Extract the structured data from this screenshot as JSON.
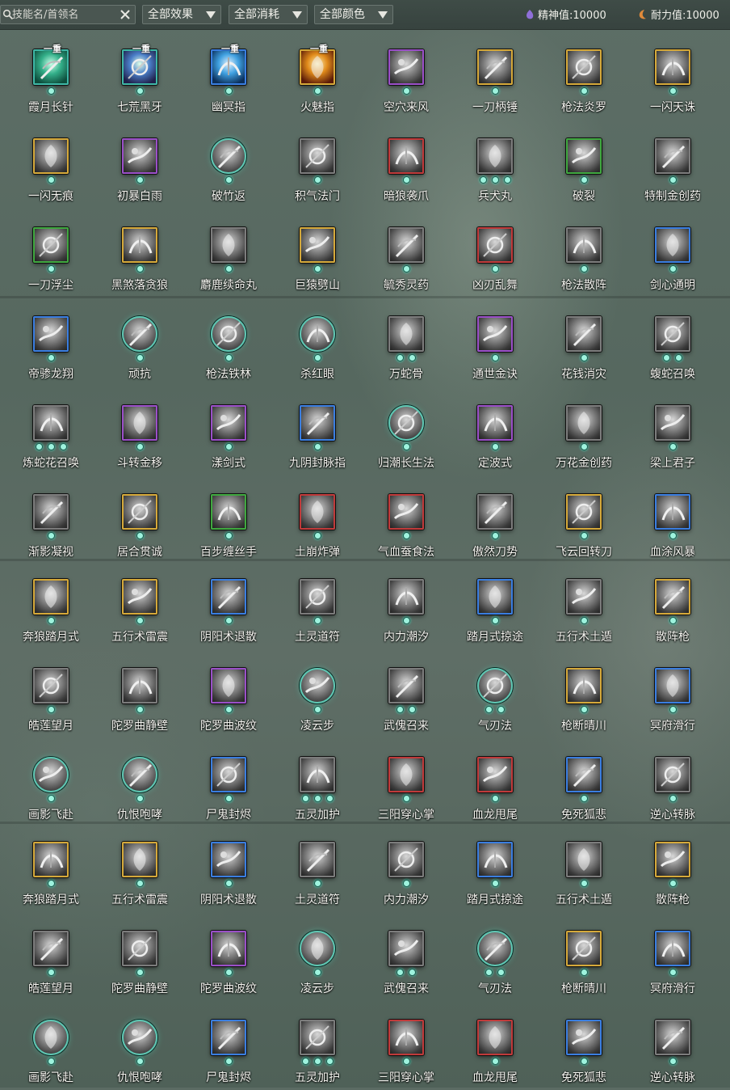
{
  "toolbar": {
    "search_placeholder": "技能名/首领名",
    "filter_effect": "全部效果",
    "filter_cost": "全部消耗",
    "filter_color": "全部颜色"
  },
  "stats": {
    "spirit_label": "精神值:",
    "spirit_value": "10000",
    "endurance_label": "耐力值:",
    "endurance_value": "10000"
  },
  "skills": [
    {
      "name": "霞月长针",
      "badge": "一重",
      "frame": "teal",
      "tint": "teal",
      "dots": 1
    },
    {
      "name": "七荒黑牙",
      "badge": "一重",
      "frame": "teal",
      "tint": "violet",
      "dots": 1
    },
    {
      "name": "幽冥指",
      "badge": "一重",
      "frame": "blue",
      "tint": "blue",
      "dots": 1
    },
    {
      "name": "火魅指",
      "badge": "一重",
      "frame": "gold",
      "tint": "fire",
      "dots": 1
    },
    {
      "name": "空穴来风",
      "frame": "purple",
      "dots": 1
    },
    {
      "name": "一刀柄锤",
      "frame": "gold",
      "dots": 1
    },
    {
      "name": "枪法炎罗",
      "frame": "gold",
      "dots": 1
    },
    {
      "name": "一闪天诛",
      "frame": "gold",
      "dots": 1
    },
    {
      "name": "一闪无痕",
      "frame": "gold",
      "dots": 1
    },
    {
      "name": "初暴白雨",
      "frame": "purple",
      "dots": 1
    },
    {
      "name": "破竹返",
      "frame": "circle",
      "dots": 1
    },
    {
      "name": "积气法门",
      "frame": "gray",
      "dots": 1
    },
    {
      "name": "暗狼袭爪",
      "frame": "red",
      "dots": 1
    },
    {
      "name": "兵犬丸",
      "frame": "gray",
      "dots": 3
    },
    {
      "name": "破裂",
      "frame": "green",
      "dots": 1
    },
    {
      "name": "特制金创药",
      "frame": "gray",
      "dots": 1
    },
    {
      "name": "一刀浮尘",
      "frame": "green",
      "dots": 1
    },
    {
      "name": "黑煞落贪狼",
      "frame": "gold",
      "dots": 1
    },
    {
      "name": "麝鹿续命丸",
      "frame": "gray",
      "dots": 1
    },
    {
      "name": "巨猿劈山",
      "frame": "gold",
      "dots": 1
    },
    {
      "name": "毓秀灵药",
      "frame": "gray",
      "dots": 1
    },
    {
      "name": "凶刃乱舞",
      "frame": "red",
      "dots": 1
    },
    {
      "name": "枪法散阵",
      "frame": "gray",
      "dots": 1
    },
    {
      "name": "剑心通明",
      "frame": "blue",
      "dots": 1
    },
    {
      "name": "帝骖龙翔",
      "frame": "blue",
      "dots": 1
    },
    {
      "name": "顽抗",
      "frame": "circle",
      "dots": 1
    },
    {
      "name": "枪法铁林",
      "frame": "circle",
      "dots": 1
    },
    {
      "name": "杀红眼",
      "frame": "circle",
      "dots": 1
    },
    {
      "name": "万蛇骨",
      "frame": "gray",
      "dots": 2
    },
    {
      "name": "通世金诀",
      "frame": "purple",
      "dots": 1
    },
    {
      "name": "花钱消灾",
      "frame": "gray",
      "dots": 1
    },
    {
      "name": "蝮蛇召唤",
      "frame": "gray",
      "dots": 2
    },
    {
      "name": "炼蛇花召唤",
      "frame": "gray",
      "dots": 3
    },
    {
      "name": "斗转金移",
      "frame": "purple",
      "dots": 1
    },
    {
      "name": "漾剑式",
      "frame": "purple",
      "dots": 1
    },
    {
      "name": "九阴封脉指",
      "frame": "blue",
      "dots": 1
    },
    {
      "name": "归潮长生法",
      "frame": "circle",
      "dots": 1
    },
    {
      "name": "定波式",
      "frame": "purple",
      "dots": 1
    },
    {
      "name": "万花金创药",
      "frame": "gray",
      "dots": 1
    },
    {
      "name": "梁上君子",
      "frame": "gray",
      "dots": 1
    },
    {
      "name": "渐影凝视",
      "frame": "gray",
      "dots": 1
    },
    {
      "name": "居合贯诚",
      "frame": "gold",
      "dots": 1
    },
    {
      "name": "百步缠丝手",
      "frame": "green",
      "dots": 1
    },
    {
      "name": "土崩炸弹",
      "frame": "red",
      "dots": 1
    },
    {
      "name": "气血蚕食法",
      "frame": "red",
      "dots": 1
    },
    {
      "name": "傲然刀势",
      "frame": "gray",
      "dots": 1
    },
    {
      "name": "飞云回转刀",
      "frame": "gold",
      "dots": 1
    },
    {
      "name": "血涂风暴",
      "frame": "blue",
      "dots": 1
    },
    {
      "name": "奔狼踏月式",
      "frame": "gold",
      "dots": 1
    },
    {
      "name": "五行术雷震",
      "frame": "gold",
      "dots": 1
    },
    {
      "name": "阴阳术退散",
      "frame": "blue",
      "dots": 1
    },
    {
      "name": "土灵道符",
      "frame": "gray",
      "dots": 1
    },
    {
      "name": "内力潮汐",
      "frame": "gray",
      "dots": 1
    },
    {
      "name": "踏月式掠途",
      "frame": "blue",
      "dots": 1
    },
    {
      "name": "五行术土遁",
      "frame": "gray",
      "dots": 1
    },
    {
      "name": "散阵枪",
      "frame": "gold",
      "dots": 1
    },
    {
      "name": "皓莲望月",
      "frame": "gray",
      "dots": 1
    },
    {
      "name": "陀罗曲静壁",
      "frame": "gray",
      "dots": 1
    },
    {
      "name": "陀罗曲波纹",
      "frame": "purple",
      "dots": 1
    },
    {
      "name": "凌云步",
      "frame": "circle",
      "dots": 1
    },
    {
      "name": "武傀召来",
      "frame": "gray",
      "dots": 2
    },
    {
      "name": "气刃法",
      "frame": "circle",
      "dots": 2
    },
    {
      "name": "枪断晴川",
      "frame": "gold",
      "dots": 1
    },
    {
      "name": "冥府滑行",
      "frame": "blue",
      "dots": 1
    },
    {
      "name": "画影飞赴",
      "frame": "circle",
      "dots": 1
    },
    {
      "name": "仇恨咆哮",
      "frame": "circle",
      "dots": 1
    },
    {
      "name": "尸鬼封烬",
      "frame": "blue",
      "dots": 1
    },
    {
      "name": "五灵加护",
      "frame": "gray",
      "dots": 3
    },
    {
      "name": "三阳穿心掌",
      "frame": "red",
      "dots": 1
    },
    {
      "name": "血龙甩尾",
      "frame": "red",
      "dots": 1
    },
    {
      "name": "免死狐悲",
      "frame": "blue",
      "dots": 1
    },
    {
      "name": "逆心转脉",
      "frame": "gray",
      "dots": 1
    },
    {
      "name": "奔狼踏月式",
      "frame": "gold",
      "dots": 1
    },
    {
      "name": "五行术雷震",
      "frame": "gold",
      "dots": 1
    },
    {
      "name": "阴阳术退散",
      "frame": "blue",
      "dots": 1
    },
    {
      "name": "土灵道符",
      "frame": "gray",
      "dots": 1
    },
    {
      "name": "内力潮汐",
      "frame": "gray",
      "dots": 1
    },
    {
      "name": "踏月式掠途",
      "frame": "blue",
      "dots": 1
    },
    {
      "name": "五行术土遁",
      "frame": "gray",
      "dots": 1
    },
    {
      "name": "散阵枪",
      "frame": "gold",
      "dots": 1
    },
    {
      "name": "皓莲望月",
      "frame": "gray",
      "dots": 1
    },
    {
      "name": "陀罗曲静壁",
      "frame": "gray",
      "dots": 1
    },
    {
      "name": "陀罗曲波纹",
      "frame": "purple",
      "dots": 1
    },
    {
      "name": "凌云步",
      "frame": "circle",
      "dots": 1
    },
    {
      "name": "武傀召来",
      "frame": "gray",
      "dots": 2
    },
    {
      "name": "气刃法",
      "frame": "circle",
      "dots": 2
    },
    {
      "name": "枪断晴川",
      "frame": "gold",
      "dots": 1
    },
    {
      "name": "冥府滑行",
      "frame": "blue",
      "dots": 1
    },
    {
      "name": "画影飞赴",
      "frame": "circle",
      "dots": 1
    },
    {
      "name": "仇恨咆哮",
      "frame": "circle",
      "dots": 1
    },
    {
      "name": "尸鬼封烬",
      "frame": "blue",
      "dots": 1
    },
    {
      "name": "五灵加护",
      "frame": "gray",
      "dots": 3
    },
    {
      "name": "三阳穿心掌",
      "frame": "red",
      "dots": 1
    },
    {
      "name": "血龙甩尾",
      "frame": "red",
      "dots": 1
    },
    {
      "name": "免死狐悲",
      "frame": "blue",
      "dots": 1
    },
    {
      "name": "逆心转脉",
      "frame": "gray",
      "dots": 1
    }
  ]
}
